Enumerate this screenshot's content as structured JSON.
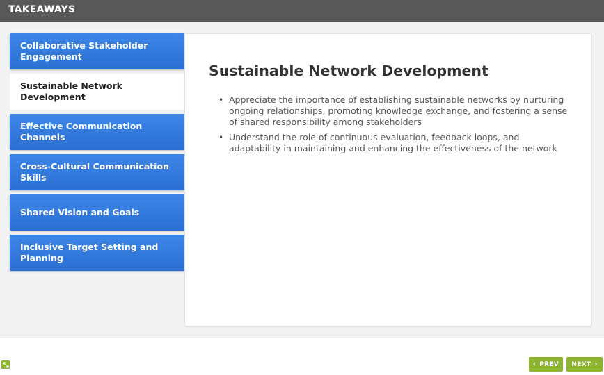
{
  "header": {
    "title": "TAKEAWAYS"
  },
  "tabs": [
    {
      "label": "Collaborative Stakeholder Engagement",
      "active": false
    },
    {
      "label": "Sustainable Network Development",
      "active": true
    },
    {
      "label": "Effective Communication Channels",
      "active": false
    },
    {
      "label": "Cross-Cultural Communication Skills",
      "active": false
    },
    {
      "label": "Shared Vision and Goals",
      "active": false
    },
    {
      "label": "Inclusive Target Setting and Planning",
      "active": false
    }
  ],
  "content": {
    "title": "Sustainable Network Development",
    "bullets": [
      "Appreciate the importance of establishing sustainable networks by nurturing ongoing relationships, promoting knowledge exchange, and fostering a sense of shared responsibility among stakeholders",
      "Understand the role of continuous evaluation, feedback loops, and adaptability in maintaining and enhancing the effectiveness of the network"
    ]
  },
  "footer": {
    "prev_label": "PREV",
    "next_label": "NEXT",
    "expand_icon": "expand-icon"
  },
  "colors": {
    "header_bg": "#595959",
    "tab_blue": "#2f76d6",
    "nav_green": "#8db531"
  }
}
